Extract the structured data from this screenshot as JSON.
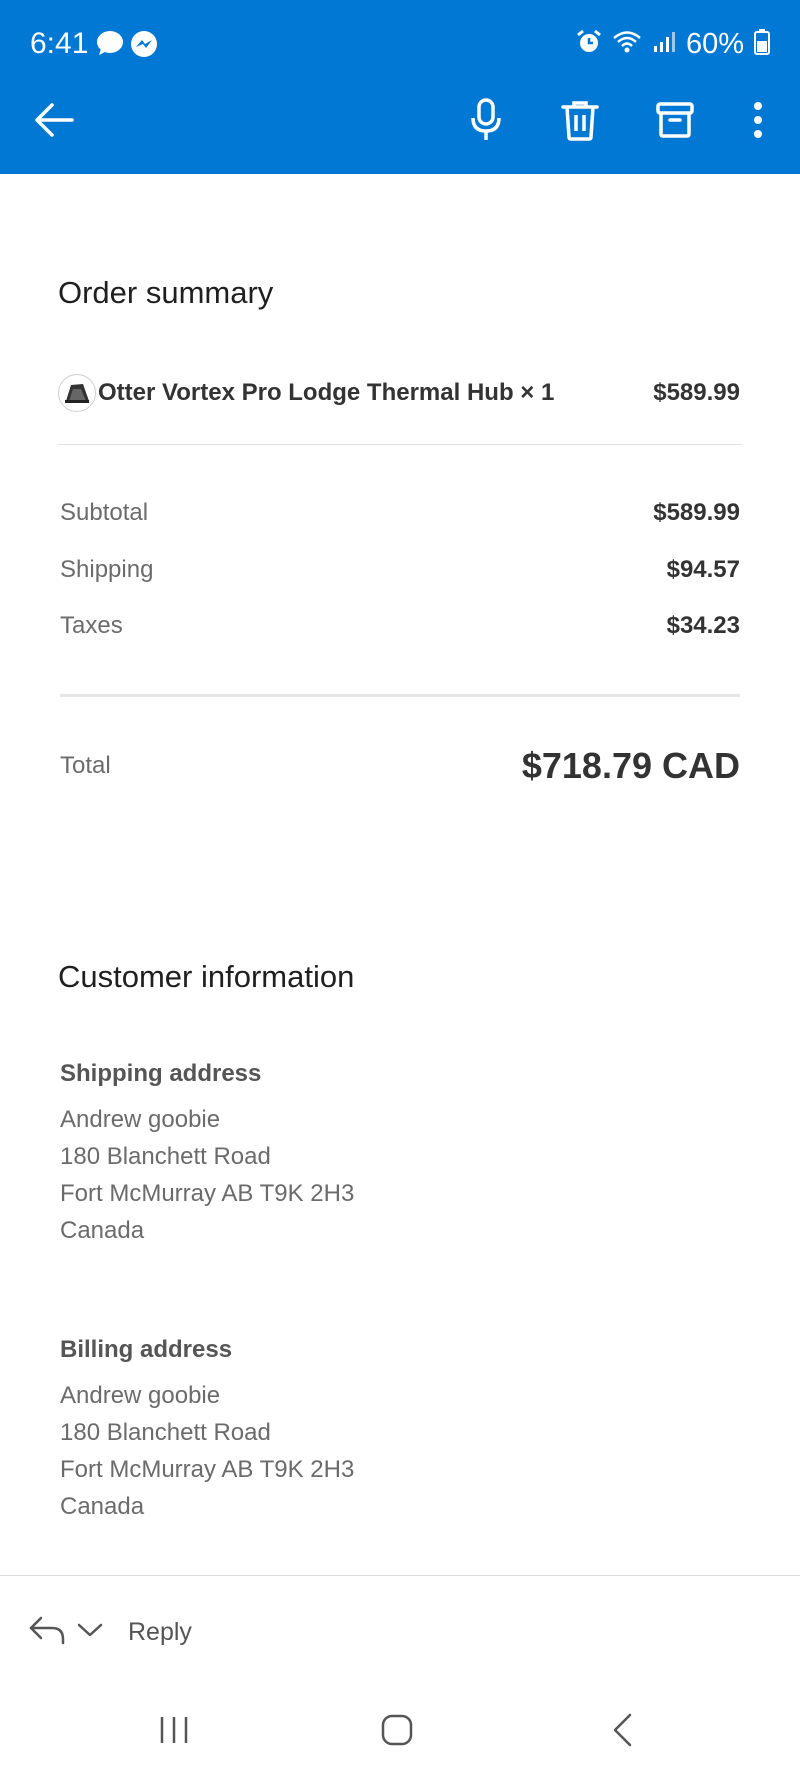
{
  "status_bar": {
    "time": "6:41",
    "battery": "60%",
    "left_icons": [
      "chat-bubble-icon",
      "messenger-icon"
    ],
    "right_icons": [
      "alarm-icon",
      "wifi-icon",
      "signal-icon",
      "battery-icon"
    ]
  },
  "toolbar": {
    "back_icon": "back-arrow-icon",
    "actions": [
      "microphone-icon",
      "trash-icon",
      "archive-icon",
      "more-vertical-icon"
    ]
  },
  "order_summary": {
    "title": "Order summary",
    "item": {
      "name": "Otter Vortex Pro Lodge Thermal Hub × 1",
      "price": "$589.99"
    },
    "subtotal_label": "Subtotal",
    "subtotal_value": "$589.99",
    "shipping_label": "Shipping",
    "shipping_value": "$94.57",
    "taxes_label": "Taxes",
    "taxes_value": "$34.23",
    "total_label": "Total",
    "total_value": "$718.79 CAD"
  },
  "customer_info": {
    "title": "Customer information",
    "shipping": {
      "heading": "Shipping address",
      "lines": [
        "Andrew goobie",
        "180 Blanchett Road",
        "Fort McMurray AB T9K 2H3",
        "Canada"
      ]
    },
    "billing": {
      "heading": "Billing address",
      "lines": [
        "Andrew goobie",
        "180 Blanchett Road",
        "Fort McMurray AB T9K 2H3",
        "Canada"
      ]
    }
  },
  "reply_bar": {
    "label": "Reply"
  },
  "colors": {
    "header_blue": "#0078d4"
  }
}
